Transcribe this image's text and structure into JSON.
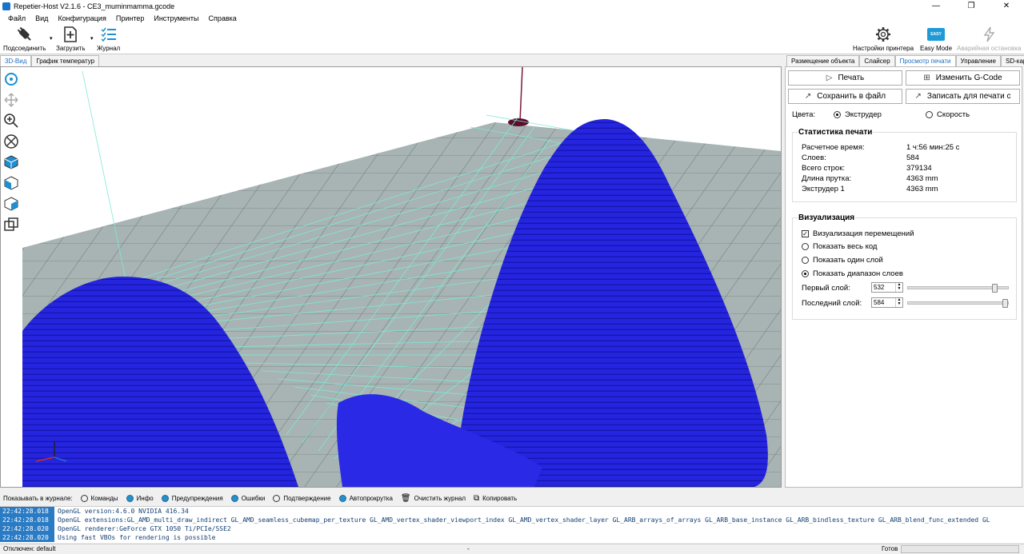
{
  "window": {
    "title": "Repetier-Host V2.1.6 - CE3_muminmamma.gcode",
    "minimize": "—",
    "maximize": "❐",
    "close": "✕"
  },
  "menu": [
    "Файл",
    "Вид",
    "Конфигурация",
    "Принтер",
    "Инструменты",
    "Справка"
  ],
  "toolbar": {
    "connect": "Подсоединить",
    "load": "Загрузить",
    "log": "Журнал",
    "printer_settings": "Настройки принтера",
    "easy_mode": "Easy Mode",
    "easy_badge": "EASY",
    "emergency_stop": "Аварийная остановка"
  },
  "left_tabs": [
    "3D-Вид",
    "График температур"
  ],
  "right_tabs": [
    "Размещение объекта",
    "Слайсер",
    "Просмотр печати",
    "Управление",
    "SD-карта"
  ],
  "preview": {
    "print_btn": "Печать",
    "edit_gcode_btn": "Изменить G-Code",
    "save_btn": "Сохранить в файл",
    "write_btn": "Записать для печати с",
    "colors_label": "Цвета:",
    "color_extruder": "Экструдер",
    "color_speed": "Скорость",
    "stats_title": "Статистика печати",
    "stats": [
      {
        "label": "Расчетное время:",
        "value": "1 ч:56 мин:25 с"
      },
      {
        "label": "Слоев:",
        "value": "584"
      },
      {
        "label": "Всего строк:",
        "value": "379134"
      },
      {
        "label": "Длина прутка:",
        "value": "4363 mm"
      },
      {
        "label": "Экструдер 1",
        "value": "4363 mm"
      }
    ],
    "vis_title": "Визуализация",
    "vis_moves": "Визуализация перемещений",
    "show_all": "Показать весь код",
    "show_one": "Показать один слой",
    "show_range": "Показать диапазон слоев",
    "first_layer_label": "Первый слой:",
    "first_layer": "532",
    "last_layer_label": "Последний слой:",
    "last_layer": "584"
  },
  "logbar": {
    "label": "Показывать в журнале:",
    "commands": "Команды",
    "info": "Инфо",
    "warnings": "Предупреждения",
    "errors": "Ошибки",
    "ack": "Подтверждение",
    "autoscroll": "Автопрокрутка",
    "clear": "Очистить журнал",
    "copy": "Копировать"
  },
  "log": [
    {
      "time": "22:42:28.018",
      "msg": "OpenGL version:4.6.0 NVIDIA 416.34"
    },
    {
      "time": "22:42:28.018",
      "msg": "OpenGL extensions:GL_AMD_multi_draw_indirect GL_AMD_seamless_cubemap_per_texture GL_AMD_vertex_shader_viewport_index GL_AMD_vertex_shader_layer GL_ARB_arrays_of_arrays GL_ARB_base_instance GL_ARB_bindless_texture GL_ARB_blend_func_extended GL"
    },
    {
      "time": "22:42:28.020",
      "msg": "OpenGL renderer:GeForce GTX 1050 Ti/PCIe/SSE2"
    },
    {
      "time": "22:42:28.020",
      "msg": "Using fast VBOs for rendering is possible"
    }
  ],
  "status": {
    "left": "Отключен: default",
    "middle": "-",
    "right": "Готов"
  }
}
